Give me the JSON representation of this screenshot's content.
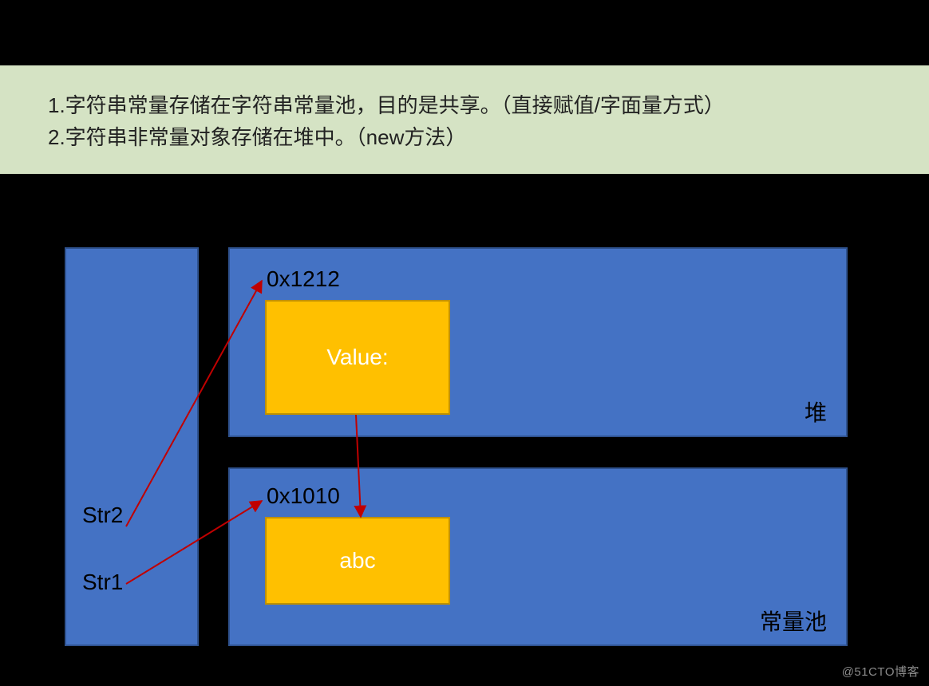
{
  "notes": {
    "line1": "1.字符串常量存储在字符串常量池，目的是共享。（直接赋值/字面量方式）",
    "line2": "2.字符串非常量对象存储在堆中。（new方法）"
  },
  "stack": {
    "str2": "Str2",
    "str1": "Str1"
  },
  "heap": {
    "address": "0x1212",
    "value_label": "Value:",
    "region_label": "堆"
  },
  "pool": {
    "address": "0x1010",
    "value_label": "abc",
    "region_label": "常量池"
  },
  "watermark": "@51CTO博客",
  "colors": {
    "note_bg": "#d5e3c4",
    "box_fill": "#4472c4",
    "box_border": "#2f528f",
    "inner_fill": "#ffc000",
    "inner_border": "#bf9000",
    "arrow": "#c00000"
  }
}
